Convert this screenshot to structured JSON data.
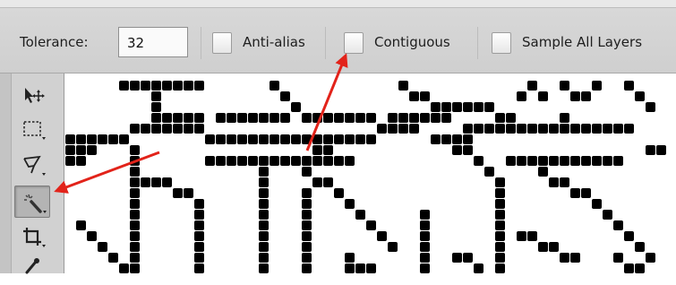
{
  "options_bar": {
    "tolerance_label": "Tolerance:",
    "tolerance_value": "32",
    "anti_alias_label": "Anti-alias",
    "anti_alias_checked": false,
    "contiguous_label": "Contiguous",
    "contiguous_checked": false,
    "sample_all_label": "Sample All Layers",
    "sample_all_checked": false
  },
  "tools": [
    {
      "name": "move-tool",
      "icon": "move-icon",
      "active": false
    },
    {
      "name": "marquee-tool",
      "icon": "rect-marquee-icon",
      "active": false
    },
    {
      "name": "lasso-tool",
      "icon": "lasso-icon",
      "active": false
    },
    {
      "name": "magic-wand-tool",
      "icon": "magic-wand-icon",
      "active": true
    },
    {
      "name": "crop-tool",
      "icon": "crop-icon",
      "active": false
    },
    {
      "name": "eyedropper-tool",
      "icon": "eyedropper-icon",
      "active": false
    }
  ],
  "annotations": {
    "arrow_color": "#e2231a"
  },
  "colors": {
    "pixel_pattern": "#000000",
    "canvas_bg": "#ffffff"
  }
}
